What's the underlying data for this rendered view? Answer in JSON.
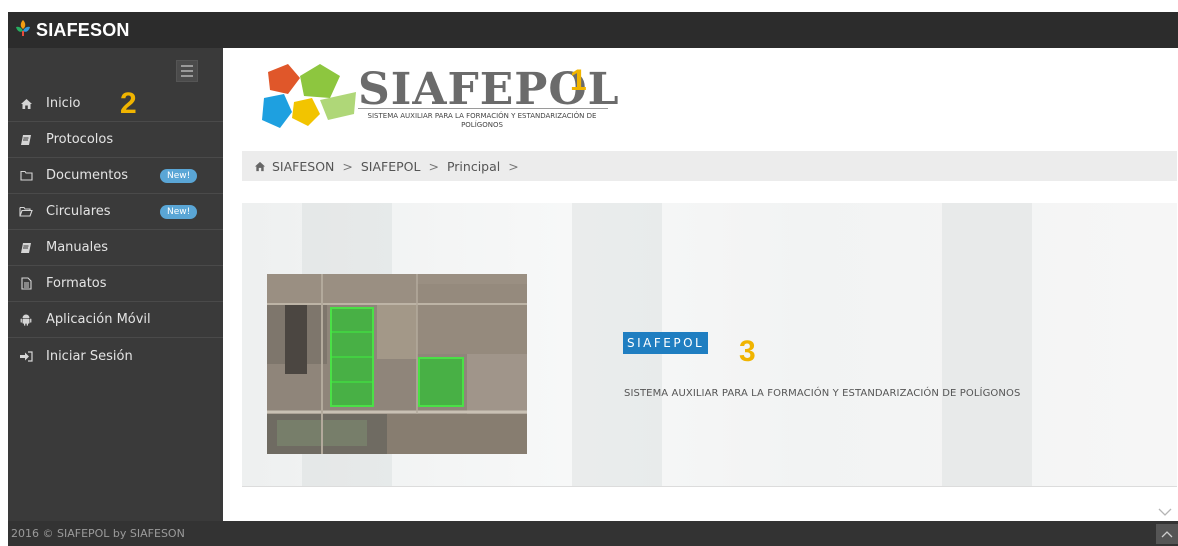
{
  "app": {
    "title": "SIAFESON"
  },
  "logo": {
    "word": "SIAFEPOL",
    "subtitle": "SISTEMA AUXILIAR PARA LA FORMACIÓN Y ESTANDARIZACIÓN DE POLÍGONOS"
  },
  "markers": {
    "one": "1",
    "two": "2",
    "three": "3"
  },
  "sidebar": {
    "items": [
      {
        "label": "Inicio",
        "icon": "home-icon"
      },
      {
        "label": "Protocolos",
        "icon": "book-icon"
      },
      {
        "label": "Documentos",
        "icon": "folder-icon",
        "badge": "New!"
      },
      {
        "label": "Circulares",
        "icon": "folder-open-icon",
        "badge": "New!"
      },
      {
        "label": "Manuales",
        "icon": "book-icon"
      },
      {
        "label": "Formatos",
        "icon": "file-text-icon"
      },
      {
        "label": "Aplicación Móvil",
        "icon": "android-icon"
      },
      {
        "label": "Iniciar Sesión",
        "icon": "sign-in-icon"
      }
    ]
  },
  "breadcrumb": {
    "items": [
      "SIAFESON",
      "SIAFEPOL",
      "Principal"
    ],
    "separator": ">"
  },
  "hero": {
    "tag": "SIAFEPOL",
    "description": "SISTEMA AUXILIAR PARA LA FORMACIÓN Y ESTANDARIZACIÓN DE POLÍGONOS"
  },
  "footer": {
    "copyright": "2016 © SIAFEPOL by SIAFESON"
  },
  "colors": {
    "accent": "#1f7ec1",
    "marker": "#f0b400",
    "sidebar": "#3a3a3a",
    "topbar": "#2c2c2c",
    "badge": "#5aa6d6",
    "polygon": "#2ecc2e"
  }
}
